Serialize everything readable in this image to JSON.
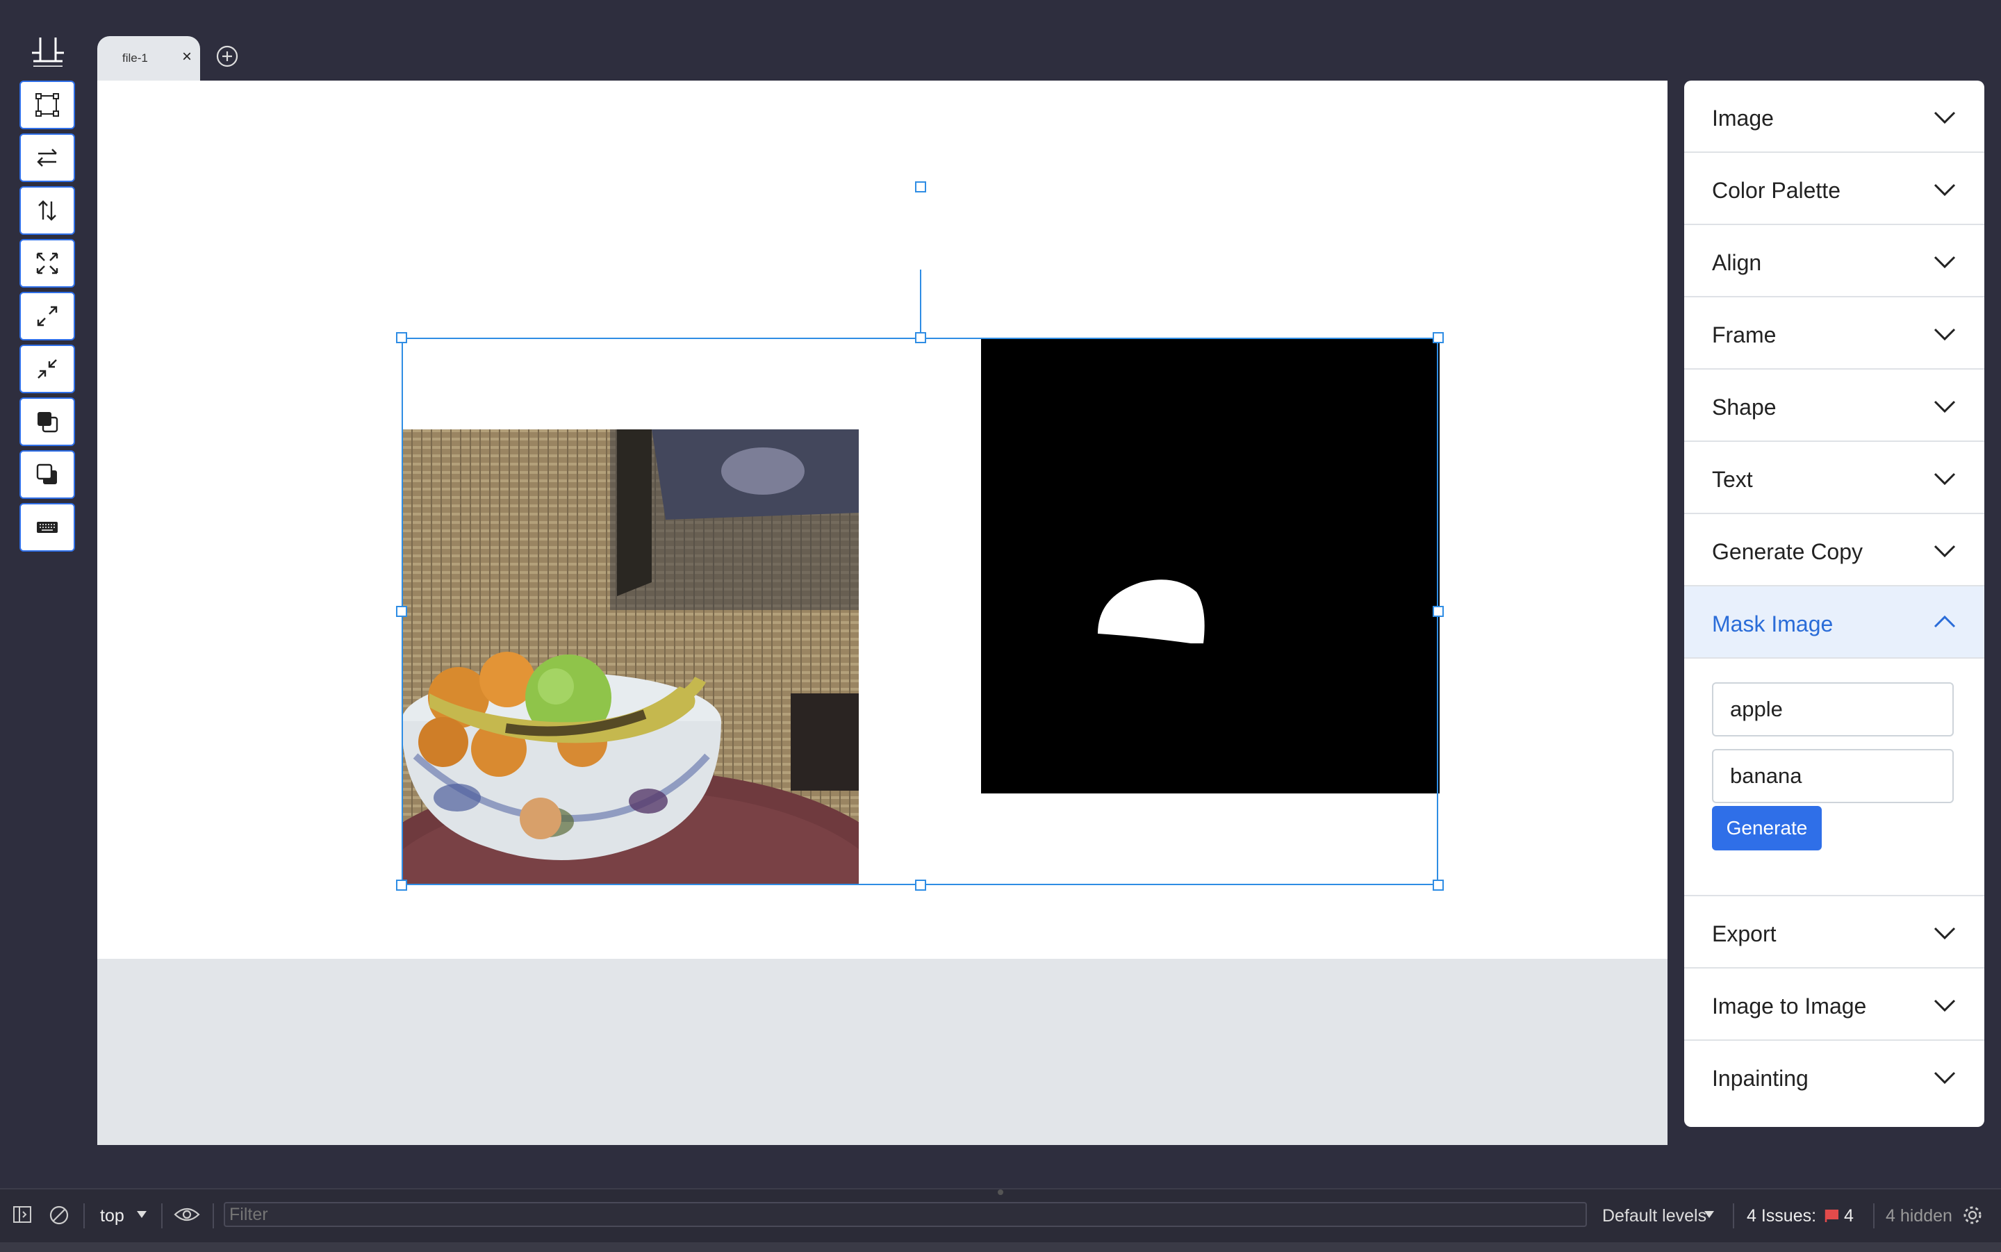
{
  "tabs": [
    {
      "label": "file-1",
      "close_label": "×"
    }
  ],
  "toolbar": {
    "tools": [
      "frame-icon",
      "flip-horizontal-icon",
      "flip-vertical-icon",
      "fit-icon",
      "expand-icon",
      "shrink-icon",
      "bring-front-icon",
      "send-back-icon",
      "keyboard-icon"
    ]
  },
  "panel": {
    "sections_top": [
      "Image",
      "Color Palette",
      "Align",
      "Frame",
      "Shape",
      "Text",
      "Generate Copy"
    ],
    "active_section": "Mask Image",
    "mask_inputs": [
      "apple",
      "banana"
    ],
    "generate_label": "Generate",
    "sections_bottom": [
      "Export",
      "Image to Image",
      "Inpainting"
    ]
  },
  "devtools": {
    "context": "top",
    "filter_placeholder": "Filter",
    "levels": "Default levels",
    "issues_label": "4 Issues:",
    "issues_count": "4",
    "hidden": "4 hidden"
  },
  "colors": {
    "accent": "#2f6fe8",
    "selection": "#2f8de4",
    "background": "#2e2e3e"
  }
}
